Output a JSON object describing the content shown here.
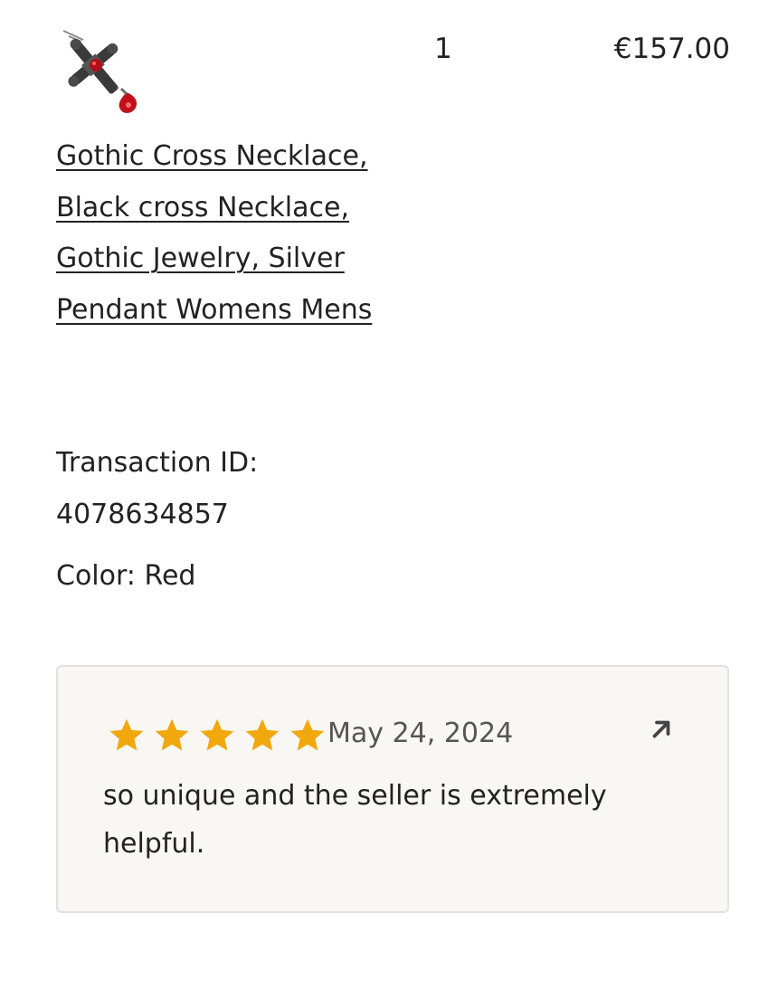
{
  "item": {
    "image_alt": "Gothic Cross Necklace pendant with red stones",
    "quantity": "1",
    "price": "€157.00",
    "title": "Gothic Cross Necklace, Black cross Necklace, Gothic Jewelry, Silver Pendant Womens Mens",
    "transaction_label": "Transaction ID:",
    "transaction_id": "4078634857",
    "variation": "Color: Red"
  },
  "review": {
    "rating": 5,
    "date": "May 24, 2024",
    "text": "so unique and the seller is extremely helpful.",
    "star_color": "#f1a80d",
    "open_icon": "arrow-up-right-icon"
  }
}
